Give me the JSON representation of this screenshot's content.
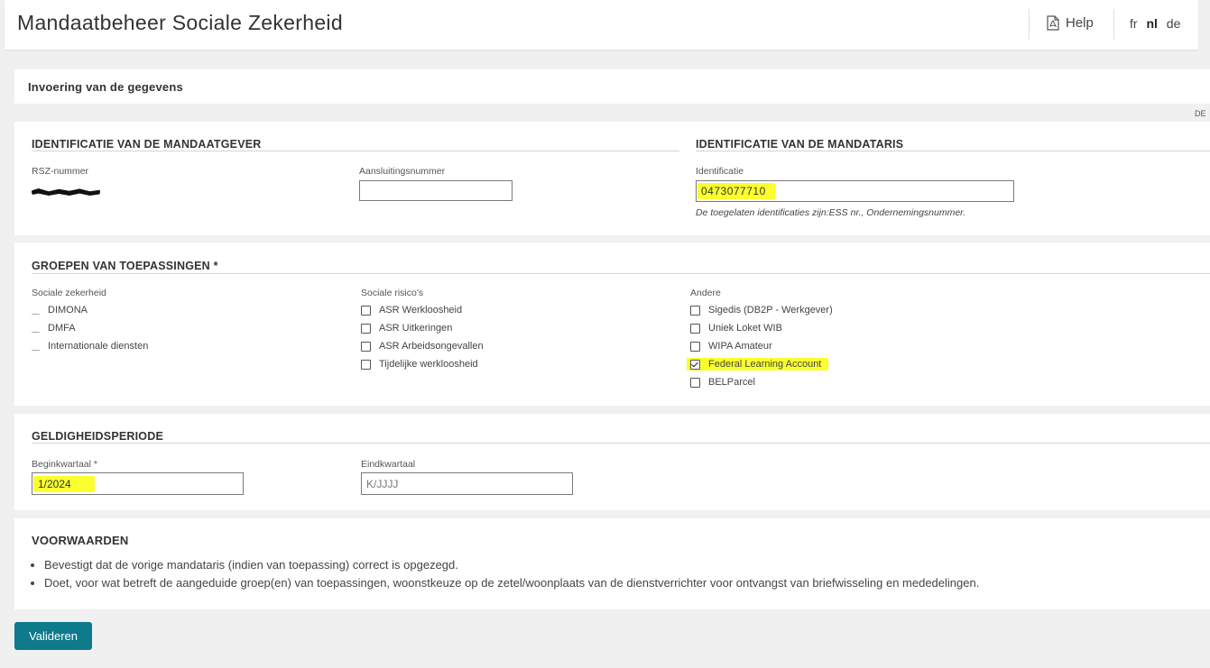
{
  "header": {
    "title": "Mandaatbeheer Sociale Zekerheid",
    "help_label": "Help",
    "help_icon": "pdf-file-icon",
    "languages": [
      {
        "code": "fr",
        "active": false
      },
      {
        "code": "nl",
        "active": true
      },
      {
        "code": "de",
        "active": false
      }
    ]
  },
  "entry_panel": {
    "title": "Invoering van de gegevens",
    "edge_text": "DE"
  },
  "identification": {
    "mandator": {
      "title": "IDENTIFICATIE VAN DE MANDAATGEVER",
      "rsz_label": "RSZ-nummer",
      "affiliation_label": "Aansluitingsnummer",
      "affiliation_value": ""
    },
    "mandatary": {
      "title": "IDENTIFICATIE VAN DE MANDATARIS",
      "id_label": "Identificatie",
      "id_value": "0473077710",
      "hint": "De toegelaten identificaties zijn:ESS nr., Ondernemingsnummer."
    }
  },
  "groups": {
    "title": "GROEPEN VAN TOEPASSINGEN *",
    "columns": [
      {
        "header": "Sociale zekerheid",
        "items": [
          {
            "label": "DIMONA",
            "checked": false
          },
          {
            "label": "DMFA",
            "checked": false
          },
          {
            "label": "Internationale diensten",
            "checked": false
          }
        ]
      },
      {
        "header": "Sociale risico's",
        "items": [
          {
            "label": "ASR Werkloosheid",
            "checked": false
          },
          {
            "label": "ASR Uitkeringen",
            "checked": false
          },
          {
            "label": "ASR Arbeidsongevallen",
            "checked": false
          },
          {
            "label": "Tijdelijke werkloosheid",
            "checked": false
          }
        ]
      },
      {
        "header": "Andere",
        "items": [
          {
            "label": "Sigedis (DB2P - Werkgever)",
            "checked": false
          },
          {
            "label": "Uniek Loket WIB",
            "checked": false
          },
          {
            "label": "WIPA Amateur",
            "checked": false
          },
          {
            "label": "Federal Learning Account",
            "checked": true
          },
          {
            "label": "BELParcel",
            "checked": false
          }
        ]
      }
    ]
  },
  "validity": {
    "title": "GELDIGHEIDSPERIODE",
    "start_label": "Beginkwartaal *",
    "start_value": "1/2024",
    "end_label": "Eindkwartaal",
    "end_placeholder": "K/JJJJ"
  },
  "conditions": {
    "title": "VOORWAARDEN",
    "items": [
      "Bevestigt dat de vorige mandataris (indien van toepassing) correct is opgezegd.",
      "Doet, voor wat betreft de aangeduide groep(en) van toepassingen, woonstkeuze op de zetel/woonplaats van de dienstverrichter voor ontvangst van briefwisseling en mededelingen."
    ]
  },
  "actions": {
    "validate_label": "Valideren"
  },
  "colors": {
    "primary_button": "#0e7a8c",
    "highlight": "#fbff2e"
  }
}
